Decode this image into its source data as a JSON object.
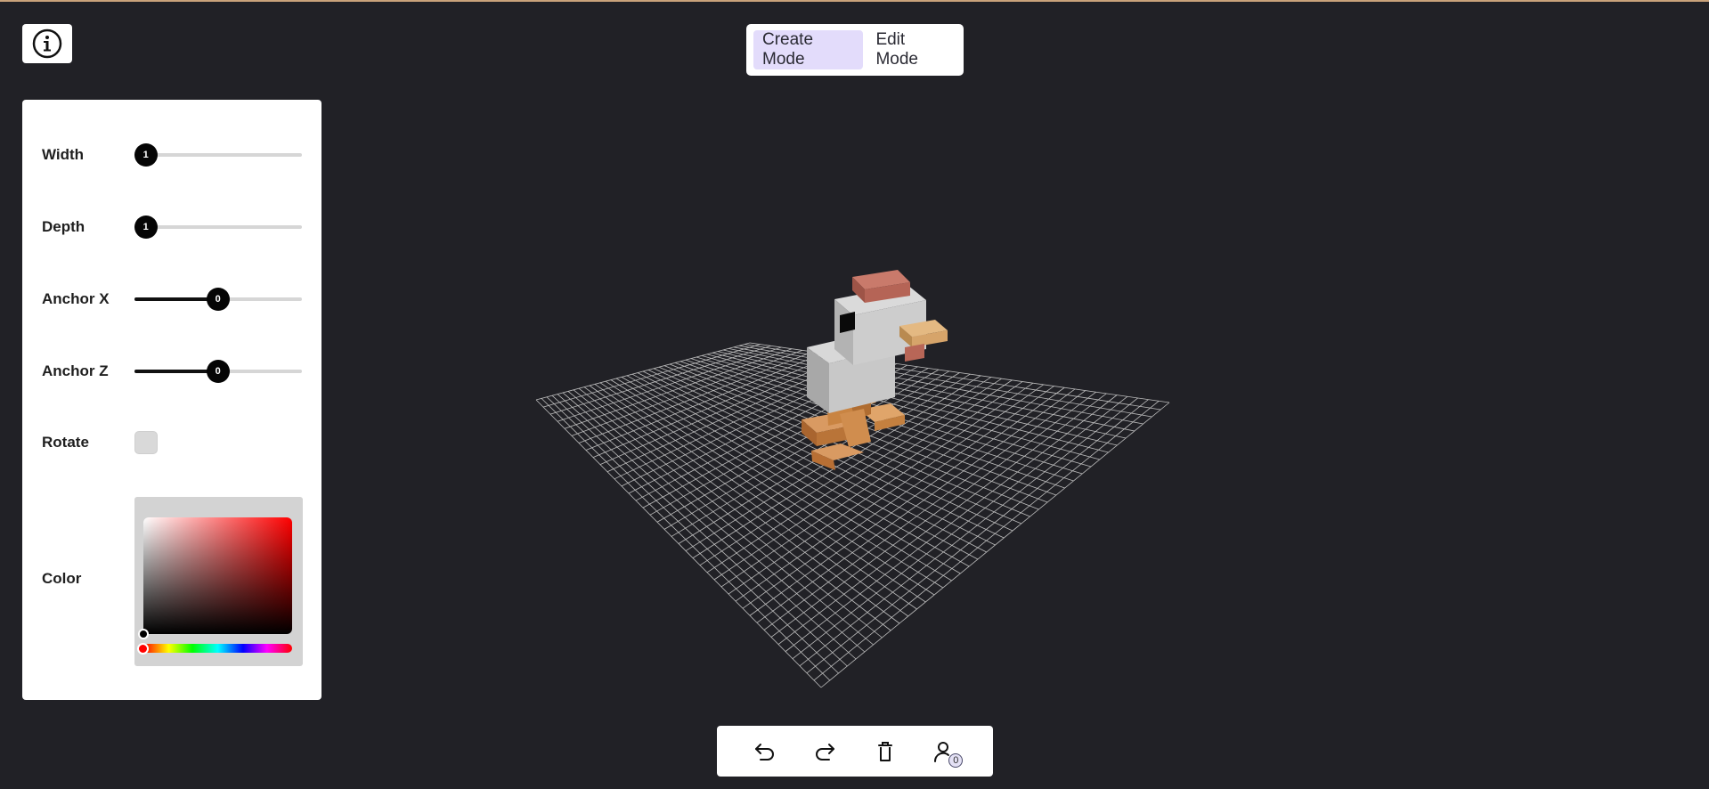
{
  "modes": [
    {
      "label": "Create Mode",
      "active": true
    },
    {
      "label": "Edit Mode",
      "active": false
    }
  ],
  "controls": {
    "width": {
      "label": "Width",
      "value": "1"
    },
    "depth": {
      "label": "Depth",
      "value": "1"
    },
    "anchor_x": {
      "label": "Anchor X",
      "value": "0"
    },
    "anchor_z": {
      "label": "Anchor Z",
      "value": "0"
    },
    "rotate": {
      "label": "Rotate",
      "checked": false
    },
    "color": {
      "label": "Color",
      "hex": "#000000",
      "hue": 0
    }
  },
  "toolbar": {
    "undo_icon": "undo-icon",
    "redo_icon": "redo-icon",
    "delete_icon": "trash-icon",
    "users_icon": "user-icon",
    "users_count": "0"
  },
  "colors": {
    "background": "#212126",
    "accent": "#e3dcfb",
    "brick_white": "#cfcfcf",
    "brick_red": "#c06b5e",
    "brick_beige": "#d8a26c",
    "brick_orange": "#d4894a"
  }
}
